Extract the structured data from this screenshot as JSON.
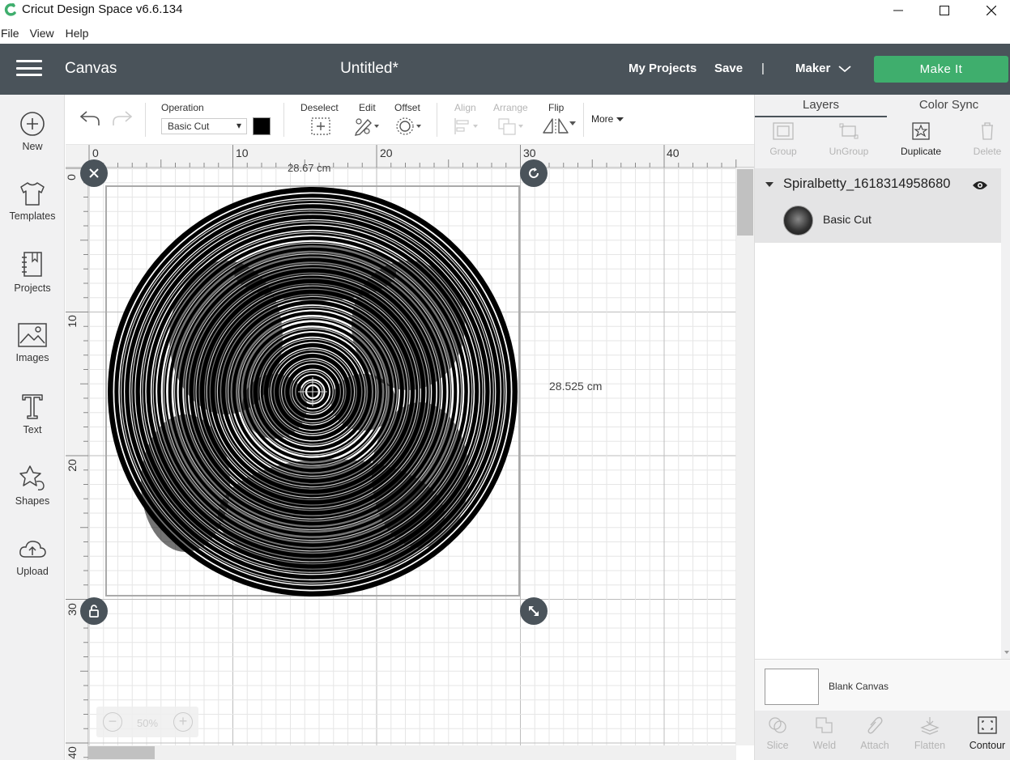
{
  "window": {
    "title": "Cricut Design Space  v6.6.134"
  },
  "menu": [
    "File",
    "View",
    "Help"
  ],
  "header": {
    "section": "Canvas",
    "doc_title": "Untitled*",
    "my_projects": "My Projects",
    "save": "Save",
    "separator": "|",
    "machine": "Maker",
    "make_it": "Make It",
    "make_it_color": "#3fae6d",
    "bar_color": "#4a535a"
  },
  "sidebar": [
    {
      "label": "New",
      "icon": "plus-circle-icon"
    },
    {
      "label": "Templates",
      "icon": "tshirt-icon"
    },
    {
      "label": "Projects",
      "icon": "notebook-icon"
    },
    {
      "label": "Images",
      "icon": "image-icon"
    },
    {
      "label": "Text",
      "icon": "text-t-icon"
    },
    {
      "label": "Shapes",
      "icon": "shapes-icon"
    },
    {
      "label": "Upload",
      "icon": "cloud-upload-icon"
    }
  ],
  "toolbar": {
    "operation_label": "Operation",
    "operation_value": "Basic Cut",
    "deselect": "Deselect",
    "edit": "Edit",
    "offset": "Offset",
    "align": "Align",
    "arrange": "Arrange",
    "flip": "Flip",
    "more": "More"
  },
  "ruler": {
    "top": [
      "0",
      "10",
      "20",
      "30",
      "40"
    ],
    "left": [
      "0",
      "10",
      "20",
      "30",
      "40"
    ]
  },
  "canvas": {
    "width_label": "28.67 cm",
    "height_label": "28.525 cm",
    "zoom": "50%",
    "zoom_minus": "−",
    "zoom_plus": "+"
  },
  "right_panel": {
    "tabs": [
      "Layers",
      "Color Sync"
    ],
    "layer_tools": [
      {
        "label": "Group",
        "enabled": false
      },
      {
        "label": "UnGroup",
        "enabled": false
      },
      {
        "label": "Duplicate",
        "enabled": true
      },
      {
        "label": "Delete",
        "enabled": false
      }
    ],
    "group_name": "Spiralbetty_1618314958680",
    "item_name": "Basic Cut",
    "blank_canvas": "Blank Canvas",
    "bottom_tools": [
      {
        "label": "Slice",
        "enabled": false
      },
      {
        "label": "Weld",
        "enabled": false
      },
      {
        "label": "Attach",
        "enabled": false
      },
      {
        "label": "Flatten",
        "enabled": false
      },
      {
        "label": "Contour",
        "enabled": true
      }
    ]
  }
}
